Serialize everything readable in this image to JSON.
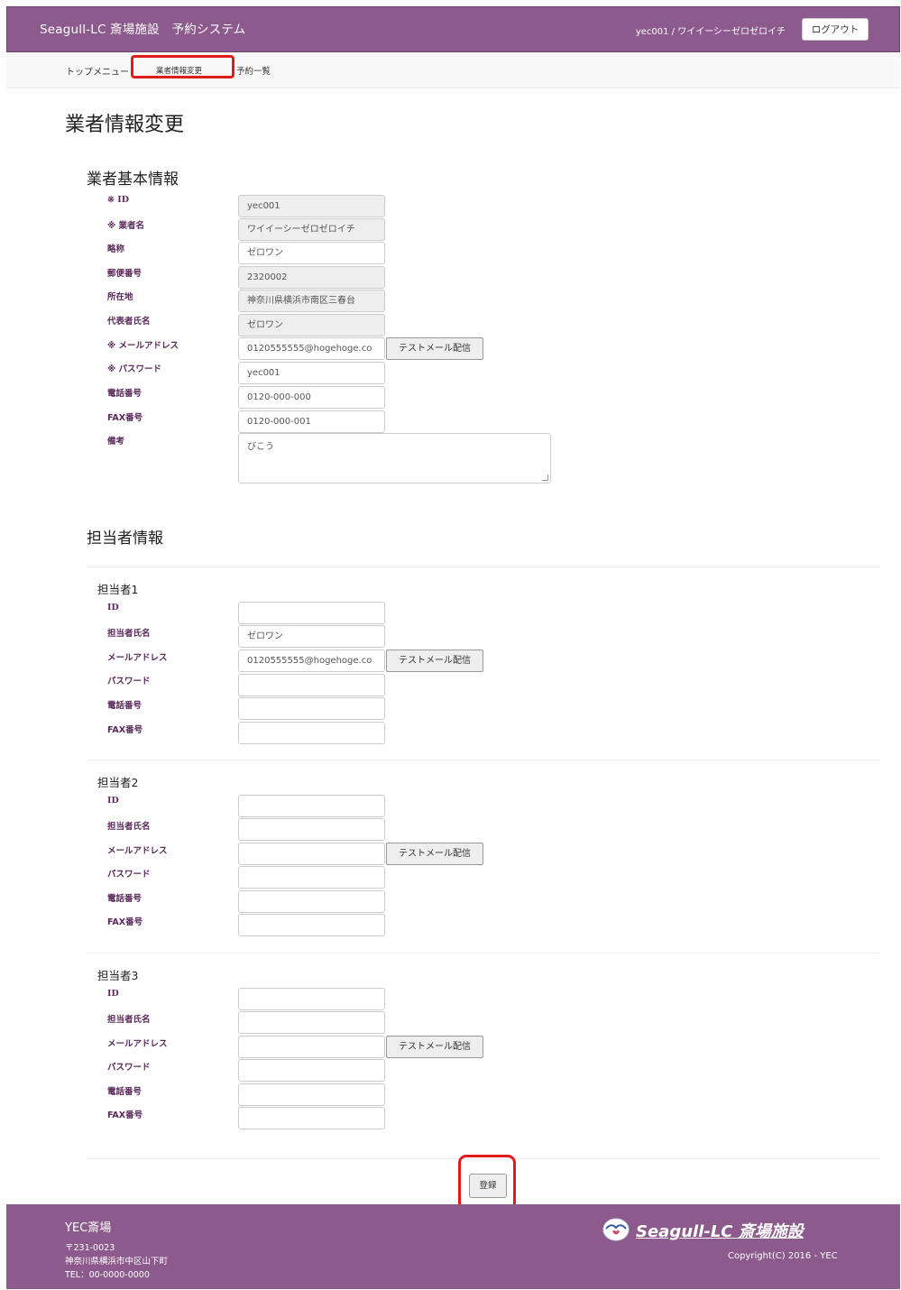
{
  "header": {
    "app_title": "Seagull-LC 斎場施設　予約システム",
    "user_label": "yec001 / ワイイーシーゼロゼロイチ",
    "logout_label": "ログアウト"
  },
  "nav": {
    "top_menu": "トップメニュー",
    "current": "業者情報変更",
    "reservations": "予約一覧"
  },
  "page_title": "業者情報変更",
  "vendor_section": {
    "title": "業者基本情報",
    "fields": [
      {
        "label": "※ ID",
        "value": "yec001",
        "readonly": true
      },
      {
        "label": "※ 業者名",
        "value": "ワイイーシーゼロゼロイチ",
        "readonly": true
      },
      {
        "label": "略称",
        "value": "ゼロワン",
        "readonly": false
      },
      {
        "label": "郵便番号",
        "value": "2320002",
        "readonly": true
      },
      {
        "label": "所在地",
        "value": "神奈川県横浜市南区三春台",
        "readonly": true
      },
      {
        "label": "代表者氏名",
        "value": "ゼロワン",
        "readonly": true
      },
      {
        "label": "※ メールアドレス",
        "value": "0120555555@hogehoge.co",
        "readonly": false
      },
      {
        "label": "※ パスワード",
        "value": "yec001",
        "readonly": false
      },
      {
        "label": "電話番号",
        "value": "0120-000-000",
        "readonly": false
      },
      {
        "label": "FAX番号",
        "value": "0120-000-001",
        "readonly": false
      }
    ],
    "notes_label": "備考",
    "notes_value": "びこう",
    "test_mail_label": "テストメール配信"
  },
  "staff_section": {
    "title": "担当者情報",
    "field_labels": [
      "ID",
      "担当者氏名",
      "メールアドレス",
      "パスワード",
      "電話番号",
      "FAX番号"
    ],
    "test_mail_label": "テストメール配信",
    "staff": [
      {
        "title": "担当者1",
        "id": "",
        "name": "ゼロワン",
        "email": "0120555555@hogehoge.co",
        "password": "",
        "phone": "",
        "fax": ""
      },
      {
        "title": "担当者2",
        "id": "",
        "name": "",
        "email": "",
        "password": "",
        "phone": "",
        "fax": ""
      },
      {
        "title": "担当者3",
        "id": "",
        "name": "",
        "email": "",
        "password": "",
        "phone": "",
        "fax": ""
      }
    ]
  },
  "register_label": "登録",
  "footer": {
    "name": "YEC斎場",
    "postal": "〒231-0023",
    "address": "神奈川県横浜市中区山下町",
    "tel": "TEL：00-0000-0000",
    "logo_text": "Seagull-LC 斎場施設",
    "copyright": "Copyright(C) 2016 - YEC"
  },
  "colors": {
    "brand": "#8c5a8c",
    "highlight": "#e01b1b"
  }
}
